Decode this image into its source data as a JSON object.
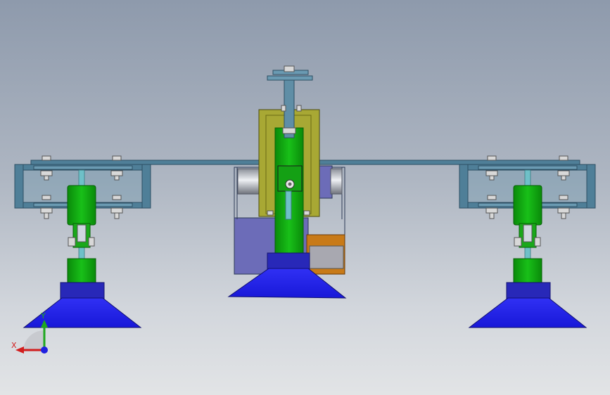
{
  "viewport": {
    "background_top": "#8e9aac",
    "background_bottom": "#e2e4e6"
  },
  "triad": {
    "x_label": "X",
    "y_label": "Y",
    "x_color": "#d21e1e",
    "y_color": "#1fa81f",
    "z_color": "#2020e0"
  },
  "model": {
    "colors": {
      "steel_frame": "#4f7f98",
      "plate_edge": "#2d4f63",
      "green_body": "#0ea10e",
      "blue_cup": "#1f1fea",
      "blue_cup_base": "#2828b8",
      "olive_bracket": "#a8a834",
      "grey_block": "#6c6cb8",
      "roller": "#b8bcc6",
      "bronze": "#c87a18"
    }
  }
}
